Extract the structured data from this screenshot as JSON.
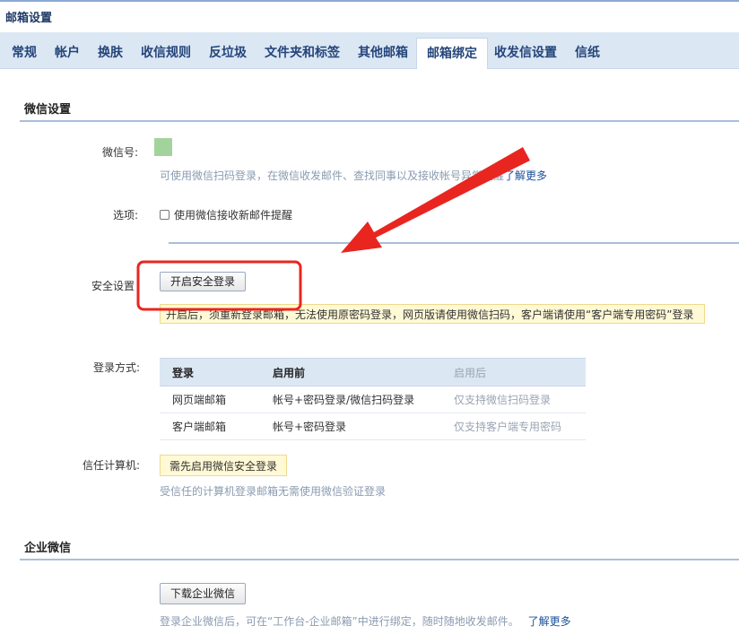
{
  "window": {
    "title": "邮箱设置"
  },
  "tabs": [
    {
      "label": "常规"
    },
    {
      "label": "帐户"
    },
    {
      "label": "换肤"
    },
    {
      "label": "收信规则"
    },
    {
      "label": "反垃圾"
    },
    {
      "label": "文件夹和标签"
    },
    {
      "label": "其他邮箱"
    },
    {
      "label": "邮箱绑定",
      "active": true
    },
    {
      "label": "收发信设置"
    },
    {
      "label": "信纸"
    }
  ],
  "wechat": {
    "section_title": "微信设置",
    "id_label": "微信号:",
    "id_hint": "可使用微信扫码登录，在微信收发邮件、查找同事以及接收帐号异常提醒",
    "learn_more": "了解更多",
    "options_label": "选项:",
    "notify_checkbox_label": "使用微信接收新邮件提醒",
    "notify_checked": false,
    "avatar_color": "#a3d39c"
  },
  "security": {
    "label": "安全设置",
    "button": "开启安全登录",
    "warning": "开启后，须重新登录邮箱，无法使用原密码登录，网页版请使用微信扫码，客户端请使用“客户端专用密码”登录"
  },
  "login_methods": {
    "label": "登录方式:",
    "headers": [
      "登录",
      "启用前",
      "启用后"
    ],
    "rows": [
      [
        "网页端邮箱",
        "帐号+密码登录/微信扫码登录",
        "仅支持微信扫码登录"
      ],
      [
        "客户端邮箱",
        "帐号+密码登录",
        "仅支持客户端专用密码"
      ]
    ]
  },
  "trusted": {
    "label": "信任计算机:",
    "badge": "需先启用微信安全登录",
    "hint": "受信任的计算机登录邮箱无需使用微信验证登录"
  },
  "enterprise": {
    "section_title": "企业微信",
    "download_button": "下载企业微信",
    "hint": "登录企业微信后，可在“工作台-企业邮箱”中进行绑定，随时随地收发邮件。",
    "learn_more": "了解更多"
  },
  "colors": {
    "accent": "#24457a",
    "annotation": "#e8261f"
  }
}
